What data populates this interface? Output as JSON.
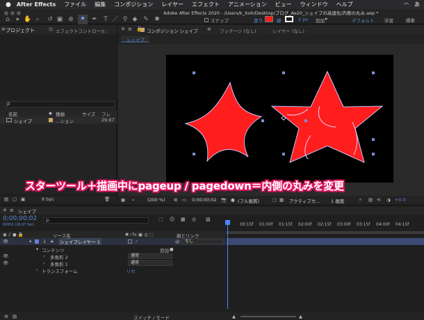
{
  "menubar": {
    "app": "After Effects",
    "items": [
      "ファイル",
      "編集",
      "コンポジション",
      "レイヤー",
      "エフェクト",
      "アニメーション",
      "ビュー",
      "ウィンドウ",
      "ヘルプ"
    ]
  },
  "window_title": "Adobe After Effects 2020 - /Users/k_itoh/Desktop/ブログ_Ae20_シェイプの高速化/内側の丸み.aep *",
  "toolbar": {
    "snap_label": "スナップ",
    "fill_label": "塗り",
    "stroke_px": "2 px",
    "add_label": "追加",
    "workspace_default": "デフォルト",
    "workspace_learn": "学習",
    "workspace_standard": "標準",
    "colors": {
      "fill": "#ff1d1d",
      "stroke": "#ffffff"
    }
  },
  "project_panel": {
    "tab_project": "プロジェクト",
    "tab_effect_controls": "エフェクトコントロール：",
    "columns": {
      "name": "名前",
      "type": "種類",
      "size": "サイズ",
      "fps": "フレ"
    },
    "item": {
      "name": "シェイプ",
      "type": "…ション",
      "fps": "29.97"
    },
    "bpc": "8 bpc"
  },
  "comp_panel": {
    "tab_comp": "コンポジション シェイプ",
    "tab_footage": "フッテージ (なし)",
    "tab_layer": "レイヤー (なし)",
    "comp_name_tab": "シェイプ",
    "zoom": "(200 %)",
    "timecode": "0;00;00;02",
    "resolution": "(フル画質)",
    "active_camera": "アクティブカ...",
    "view_count": "1 画面",
    "exposure": "+0.0",
    "shape_color": "#ff1d1d"
  },
  "caption": "スターツール＋描画中にpageup / pagedown＝内側の丸みを変更",
  "timeline": {
    "tab": "シェイプ",
    "timecode": "0;00;00;02",
    "timecode_sub": "00002 (29.97 fps)",
    "search_placeholder": "ρ.",
    "col_source": "ソース名",
    "col_parent": "親とリンク",
    "ruler": [
      "00:15f",
      "01:00f",
      "01:15f",
      "02:00f",
      "02:15f",
      "03:00f",
      "03:15f",
      "04:00f",
      "04:15f"
    ],
    "layer": {
      "num": "1",
      "name": "シェイプレイヤー 1",
      "parent": "なし"
    },
    "contents_label": "コンテンツ",
    "add_label": "追加:",
    "polystar_2": "多角形 2",
    "polystar_1": "多角形 1",
    "blend_normal_a": "通常",
    "blend_normal_b": "通常",
    "transform_label": "トランスフォーム",
    "reset_label": "リセ",
    "footer_label": "スイッチ / モード"
  }
}
